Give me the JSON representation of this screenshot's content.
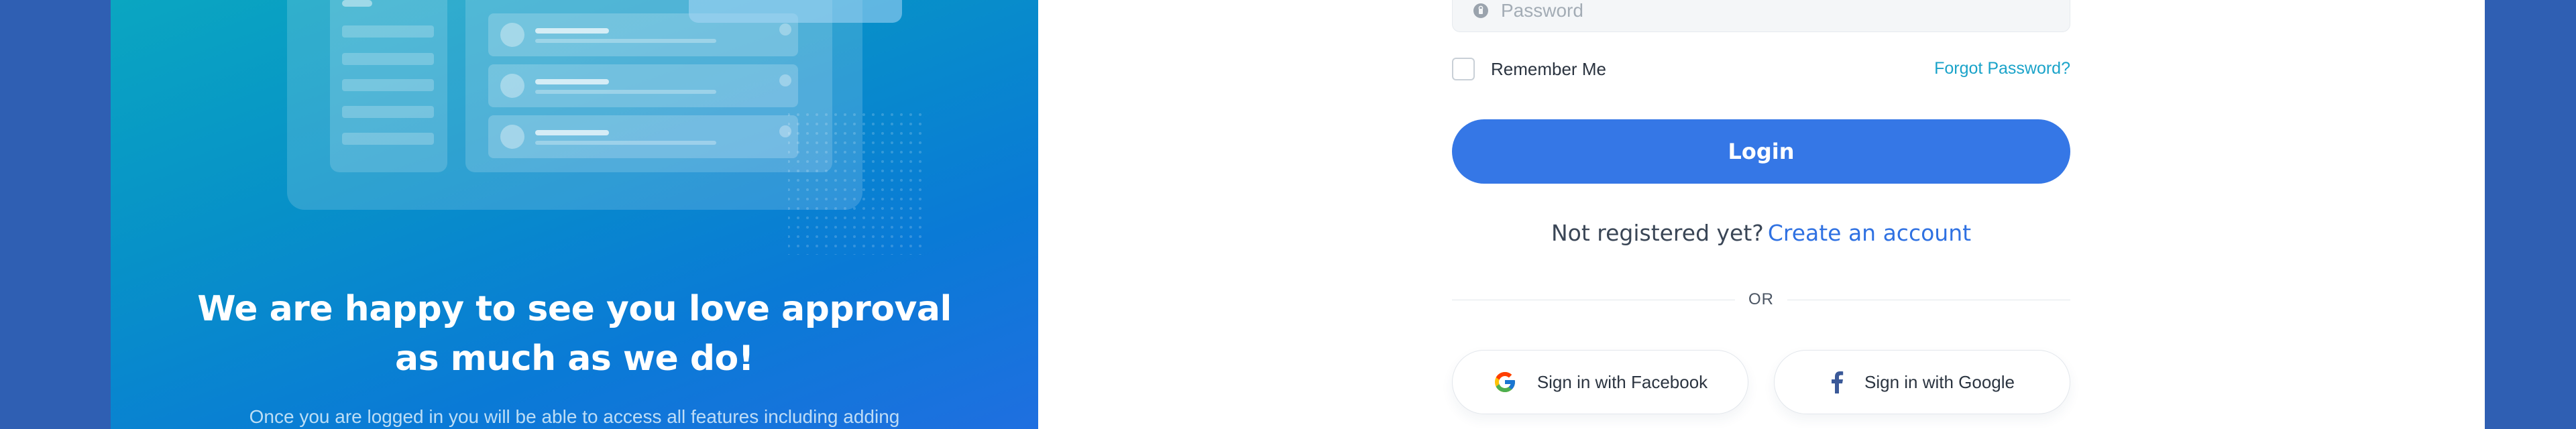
{
  "colors": {
    "page_background": "#2f5fb3",
    "card_background": "#ffffff",
    "panel_gradient_start": "#0aa6c1",
    "panel_gradient_end": "#1f6fe0",
    "primary": "#3577e6",
    "link": "#2f71e2",
    "forgot_link": "#1aa3c9"
  },
  "left_panel": {
    "headline_line1": "We are happy to see you love approval",
    "headline_line2": "as much as we do!",
    "subtext": "Once you are logged in you will be able to access all features including adding"
  },
  "form": {
    "password_placeholder": "Password",
    "remember_label": "Remember Me",
    "forgot_link": "Forgot Password?",
    "login_button": "Login",
    "not_registered": "Not registered yet?",
    "create_account": "Create an account",
    "or_divider": "OR",
    "social_left_label": "Sign in with Facebook",
    "social_left_icon": "google-icon",
    "social_right_label": "Sign in with Google",
    "social_right_icon": "facebook-icon"
  }
}
